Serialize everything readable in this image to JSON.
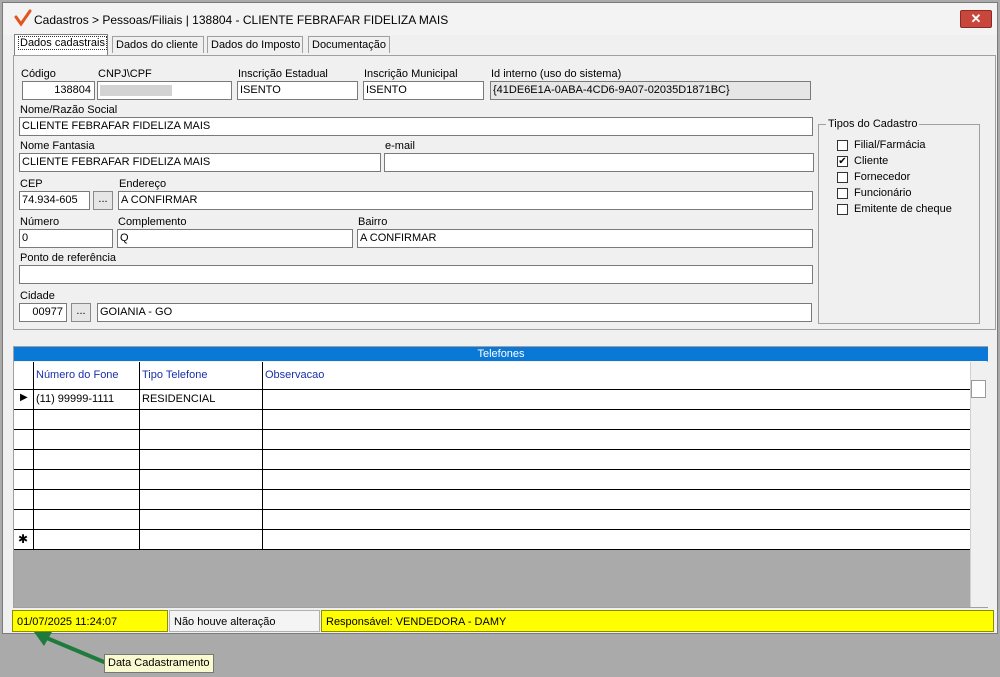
{
  "window": {
    "title": "Cadastros > Pessoas/Filiais | 138804 - CLIENTE FEBRAFAR FIDELIZA MAIS",
    "close_symbol": "✕"
  },
  "tabs": [
    {
      "label": "Dados cadastrais",
      "active": true
    },
    {
      "label": "Dados do cliente",
      "active": false
    },
    {
      "label": "Dados do Imposto",
      "active": false
    },
    {
      "label": "Documentação",
      "active": false
    }
  ],
  "form": {
    "codigo": {
      "label": "Código",
      "value": "138804"
    },
    "cnpj": {
      "label": "CNPJ\\CPF",
      "value": ""
    },
    "inscricao_estadual": {
      "label": "Inscrição Estadual",
      "value": "ISENTO"
    },
    "inscricao_municipal": {
      "label": "Inscrição Municipal",
      "value": "ISENTO"
    },
    "id_interno": {
      "label": "Id interno (uso do sistema)",
      "value": "{41DE6E1A-0ABA-4CD6-9A07-02035D1871BC}"
    },
    "nome_razao": {
      "label": "Nome/Razão Social",
      "value": "CLIENTE FEBRAFAR FIDELIZA MAIS"
    },
    "nome_fantasia": {
      "label": "Nome Fantasia",
      "value": "CLIENTE FEBRAFAR FIDELIZA MAIS"
    },
    "email": {
      "label": "e-mail",
      "value": ""
    },
    "cep": {
      "label": "CEP",
      "value": "74.934-605"
    },
    "endereco": {
      "label": "Endereço",
      "value": "A CONFIRMAR"
    },
    "numero": {
      "label": "Número",
      "value": "0"
    },
    "complemento": {
      "label": "Complemento",
      "value": "Q"
    },
    "bairro": {
      "label": "Bairro",
      "value": "A CONFIRMAR"
    },
    "ponto_referencia": {
      "label": "Ponto de referência",
      "value": ""
    },
    "cidade": {
      "label": "Cidade",
      "code": "00977",
      "value": "GOIANIA - GO"
    },
    "lookup_button": "..."
  },
  "tipos_cadastro": {
    "title": "Tipos do Cadastro",
    "items": [
      {
        "label": "Filial/Farmácia",
        "checked": false,
        "mark": ""
      },
      {
        "label": "Cliente",
        "checked": true,
        "mark": "✔"
      },
      {
        "label": "Fornecedor",
        "checked": false,
        "mark": ""
      },
      {
        "label": "Funcionário",
        "checked": false,
        "mark": ""
      },
      {
        "label": "Emitente de cheque",
        "checked": false,
        "mark": ""
      }
    ]
  },
  "telefones": {
    "title": "Telefones",
    "columns": [
      "Número do Fone",
      "Tipo Telefone",
      "Observacao"
    ],
    "rows": [
      {
        "numero": "(11) 99999-1111",
        "tipo": "RESIDENCIAL",
        "obs": ""
      }
    ],
    "current_row_marker": "▶",
    "new_row_marker": "✱"
  },
  "status_bar": {
    "data_cadastro": "01/07/2025 11:24:07",
    "alteracao": "Não houve alteração",
    "responsavel": "Responsável: VENDEDORA - DAMY"
  },
  "tooltip": "Data Cadastramento",
  "colors": {
    "highlight": "#ffff00",
    "arrow": "#1e7b3c",
    "grid_header": "#0a78d7"
  }
}
